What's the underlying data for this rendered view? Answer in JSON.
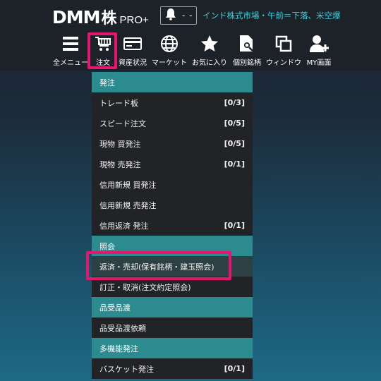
{
  "header": {
    "logo_main": "DMM",
    "logo_kabu": "株",
    "logo_pro": "PRO+",
    "notification_count": "- -",
    "news": "インド株式市場・午前＝下落、米空爆"
  },
  "toolbar": {
    "items": [
      {
        "label": "全メニュー",
        "icon": "hamburger-icon"
      },
      {
        "label": "注文",
        "icon": "cart-icon"
      },
      {
        "label": "資産状況",
        "icon": "card-icon"
      },
      {
        "label": "マーケット",
        "icon": "globe-icon"
      },
      {
        "label": "お気に入り",
        "icon": "star-icon"
      },
      {
        "label": "個別銘柄",
        "icon": "document-search-icon"
      },
      {
        "label": "ウィンドウ",
        "icon": "windows-icon"
      },
      {
        "label": "MY画面",
        "icon": "user-add-icon"
      }
    ]
  },
  "menu": {
    "sections": [
      {
        "title": "発注",
        "items": [
          {
            "label": "トレード板",
            "count": "[0/3]"
          },
          {
            "label": "スピード注文",
            "count": "[0/5]"
          },
          {
            "label": "現物 買発注",
            "count": "[0/5]"
          },
          {
            "label": "現物 売発注",
            "count": "[0/1]"
          },
          {
            "label": "信用新規 買発注",
            "count": ""
          },
          {
            "label": "信用新規 売発注",
            "count": ""
          },
          {
            "label": "信用返済 発注",
            "count": "[0/1]"
          }
        ]
      },
      {
        "title": "照会",
        "items": [
          {
            "label": "返済・売却(保有銘柄・建玉照会)",
            "count": ""
          },
          {
            "label": "訂正・取消(注文約定照会)",
            "count": ""
          }
        ]
      },
      {
        "title": "品受品渡",
        "items": [
          {
            "label": "品受品渡依頼",
            "count": ""
          }
        ]
      },
      {
        "title": "多機能発注",
        "items": [
          {
            "label": "バスケット発注",
            "count": "[0/1]"
          }
        ]
      }
    ]
  },
  "colors": {
    "accent_teal": "#2c8b8e",
    "highlight_pink": "#e4166f",
    "news_cyan": "#3fd1dd"
  }
}
